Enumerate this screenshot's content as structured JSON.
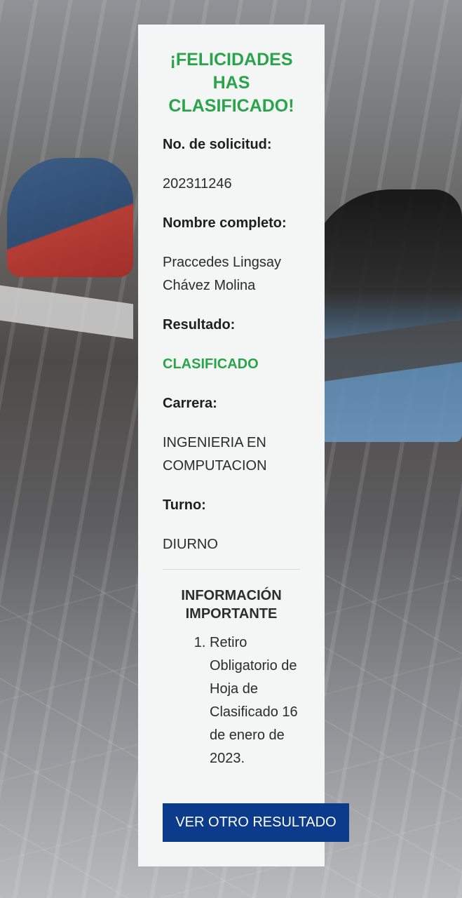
{
  "result_card": {
    "headline": "¡FELICIDADES HAS CLASIFICADO!",
    "fields": [
      {
        "label": "No. de solicitud:",
        "value": "202311246"
      },
      {
        "label": "Nombre completo:",
        "value": "Praccedes Lingsay Chávez Molina"
      },
      {
        "label": "Resultado:",
        "value": "CLASIFICADO"
      },
      {
        "label": "Carrera:",
        "value": "INGENIERIA EN COMPUTACION"
      },
      {
        "label": "Turno:",
        "value": "DIURNO"
      }
    ],
    "important_info": {
      "title": "INFORMACIÓN IMPORTANTE",
      "items": [
        "Retiro Obligatorio de Hoja de Clasificado 16 de enero de 2023."
      ]
    },
    "action_button_label": "VER OTRO RESULTADO"
  },
  "colors": {
    "accent_green": "#2aa44a",
    "button_blue": "#0d3b8c",
    "card_background": "#f4f6f6"
  }
}
